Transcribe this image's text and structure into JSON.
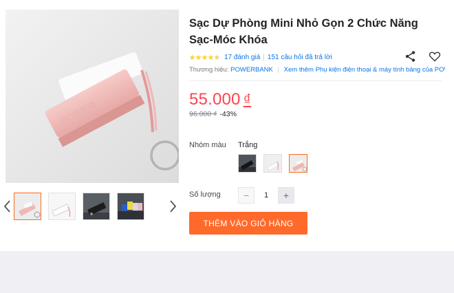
{
  "product": {
    "title": "Sạc Dự Phòng Mini Nhỏ Gọn 2 Chức Năng Sạc-Móc Khóa",
    "rating": 4.5,
    "rating_count": "17 đánh giá",
    "qa_count": "151 câu hỏi đã trả lời",
    "brand_prefix": "Thương hiệu:",
    "brand_name": "POWERBANK",
    "brand_more": "Xem thêm Phụ kiện điện thoại & máy tính bảng của POWE...",
    "price": "55.000",
    "currency": "₫",
    "old_price": "96.000 ₫",
    "discount": "-43%"
  },
  "options": {
    "color_label": "Nhóm màu",
    "color_value": "Trắng",
    "swatches": [
      "black",
      "white",
      "pink"
    ],
    "selected_swatch": "pink"
  },
  "quantity": {
    "label": "Số lượng",
    "value": "1",
    "minus": "−",
    "plus": "+"
  },
  "actions": {
    "add_to_cart": "THÊM VÀO GIỎ HÀNG"
  },
  "gallery": {
    "active_index": 0,
    "thumbs": [
      "pink-powerbank",
      "white-powerbank",
      "black-powerbank",
      "color-powerbanks"
    ]
  },
  "colors": {
    "price_red": "#ff424e",
    "accent_orange": "#ff6a2b",
    "link_blue": "#0b74e5",
    "star_yellow": "#fdd836"
  }
}
